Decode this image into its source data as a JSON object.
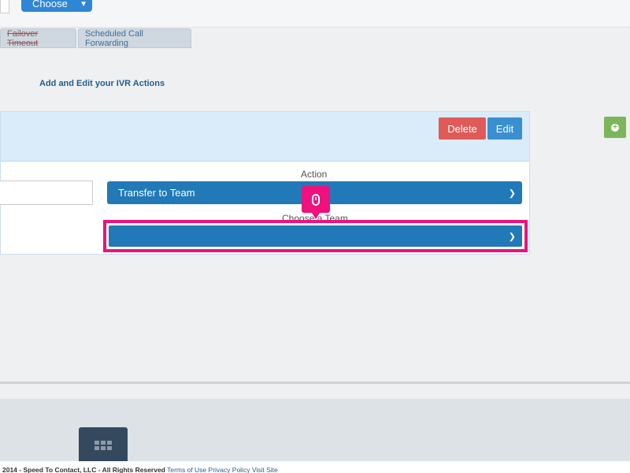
{
  "top": {
    "choose_label": "Choose"
  },
  "tabs": [
    {
      "label": "Failover Timeout"
    },
    {
      "label": "Scheduled Call Forwarding"
    }
  ],
  "section": {
    "title": "Add and Edit your IVR Actions"
  },
  "panel": {
    "delete_label": "Delete",
    "edit_label": "Edit",
    "action_label": "Action",
    "action_value": "Transfer to Team",
    "choose_team_label": "Choose a Team",
    "team_value": ""
  },
  "footer": {
    "copyright": "2014 - Speed To Contact, LLC - All Rights Reserved",
    "links": [
      "Terms of Use",
      "Privacy Policy",
      "Visit Site"
    ]
  },
  "colors": {
    "primary": "#2179b8",
    "danger": "#e05a5a",
    "success": "#7cb65a",
    "highlight": "#ee117e"
  }
}
